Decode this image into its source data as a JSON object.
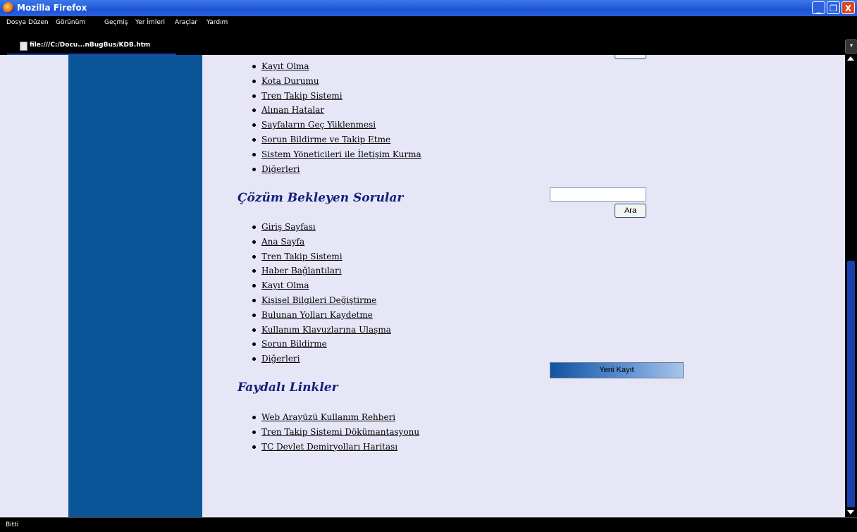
{
  "window": {
    "title": "Mozilla Firefox",
    "controls": {
      "minimize": "_",
      "maximize": "❐",
      "close": "X"
    }
  },
  "menu": [
    "Dosya",
    "Düzen",
    "Görünüm",
    "Geçmiş",
    "Yer İmleri",
    "Araçlar",
    "Yardım"
  ],
  "tab": {
    "label": "file:///C:/Docu...nBugBus/KDB.htm"
  },
  "content": {
    "list1": [
      "Kayıt Olma",
      "Kota Durumu",
      "Tren Takip Sistemi",
      "Alınan Hatalar",
      "Sayfaların Geç Yüklenmesi",
      "Sorun Bildirme ve Takip Etme",
      "Sistem Yöneticileri ile İletişim Kurma",
      "Diğerleri"
    ],
    "heading2": "Çözüm Bekleyen Sorular",
    "list2": [
      "Giriş Sayfası",
      "Ana Sayfa",
      "Tren Takip Sistemi",
      "Haber Bağlantıları",
      "Kayıt Olma",
      "Kişisel Bilgileri Değiştirme",
      "Bulunan Yolları Kaydetme",
      "Kullanım Klavuzlarına Ulaşma",
      "Sorun Bildirme",
      "Diğerleri"
    ],
    "heading3": "Faydalı Linkler",
    "list3": [
      "Web Arayüzü Kullanım Rehberi",
      "Tren Takip Sistemi Dökümantasyonu",
      "TC Devlet Demiryolları Haritası"
    ],
    "search": {
      "value": "",
      "button": "Ara"
    },
    "new_record_button": "Yeni Kayıt"
  },
  "status": "Bitti",
  "colors": {
    "sidebar": "#0b5699",
    "page_bg": "#e6e6f7",
    "heading": "#14207a"
  }
}
